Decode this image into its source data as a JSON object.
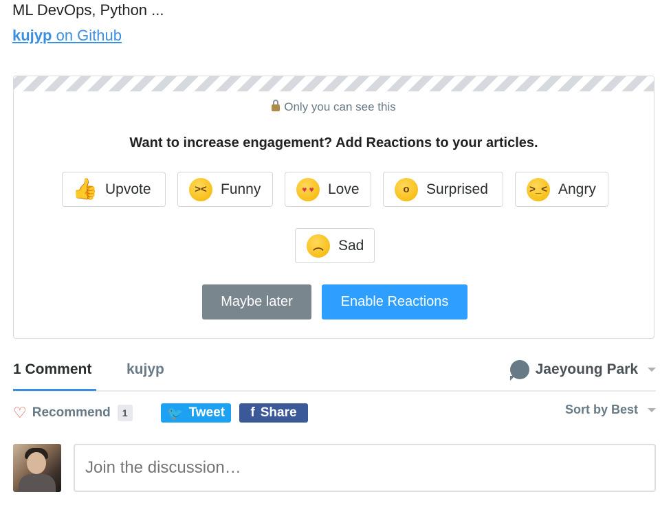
{
  "profile": {
    "bio": "ML DevOps, Python ...",
    "github_user": "kujyp",
    "github_suffix": " on Github"
  },
  "reactions_prompt": {
    "privacy_note": "Only you can see this",
    "headline": "Want to increase engagement? Add Reactions to your articles.",
    "reactions": [
      {
        "label": "Upvote",
        "icon": "thumbs-up-icon"
      },
      {
        "label": "Funny",
        "icon": "laughing-face-icon"
      },
      {
        "label": "Love",
        "icon": "heart-eyes-icon"
      },
      {
        "label": "Surprised",
        "icon": "surprised-face-icon"
      },
      {
        "label": "Angry",
        "icon": "angry-face-icon"
      },
      {
        "label": "Sad",
        "icon": "sad-face-icon"
      }
    ],
    "maybe_later_label": "Maybe later",
    "enable_label": "Enable Reactions"
  },
  "comments": {
    "tab_count_label": "1 Comment",
    "site_name": "kujyp",
    "user_name": "Jaeyoung Park",
    "recommend_label": "Recommend",
    "recommend_count": "1",
    "tweet_label": "Tweet",
    "share_label": "Share",
    "sort_label": "Sort by Best",
    "input_placeholder": "Join the discussion…"
  },
  "colors": {
    "accent": "#2e9fff",
    "link": "#3b8fe0",
    "twitter": "#1da1f2",
    "facebook": "#3b5998",
    "muted_button": "#7a868d"
  }
}
